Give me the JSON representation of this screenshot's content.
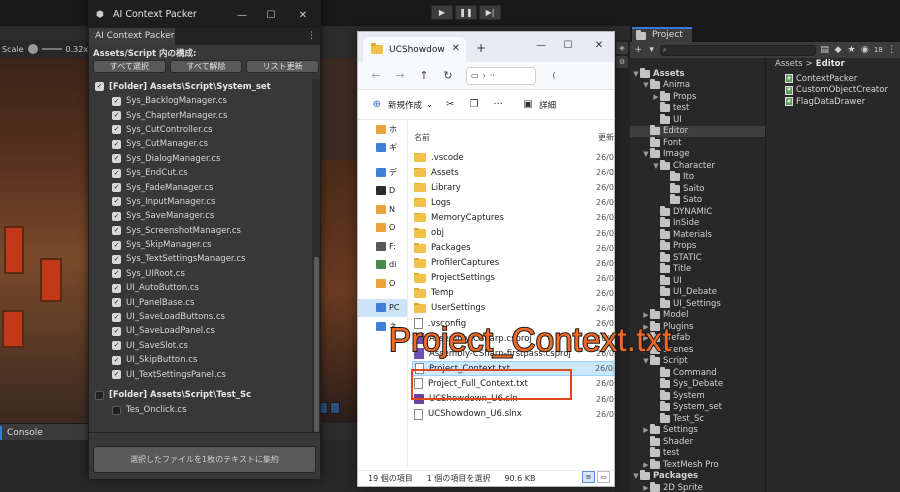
{
  "unity": {
    "play_icon": "play-icon",
    "pause_icon": "pause-icon",
    "step_icon": "step-icon",
    "scale_label": "Scale",
    "scale_value": "0.32x",
    "console_tab": "Console"
  },
  "packer": {
    "title": "AI Context Packer",
    "tab_label": "AI Context Packer",
    "heading": "Assets/Script 内の構成:",
    "btn_select_all": "すべて選択",
    "btn_deselect_all": "すべて解除",
    "btn_refresh": "リスト更新",
    "folder_1": "[Folder] Assets\\Script\\System_set",
    "files_1": [
      "Sys_BacklogManager.cs",
      "Sys_ChapterManager.cs",
      "Sys_CutController.cs",
      "Sys_CutManager.cs",
      "Sys_DialogManager.cs",
      "Sys_EndCut.cs",
      "Sys_FadeManager.cs",
      "Sys_InputManager.cs",
      "Sys_SaveManager.cs",
      "Sys_ScreenshotManager.cs",
      "Sys_SkipManager.cs",
      "Sys_TextSettingsManager.cs",
      "Sys_UIRoot.cs",
      "UI_AutoButton.cs",
      "UI_PanelBase.cs",
      "UI_SaveLoadButtons.cs",
      "UI_SaveLoadPanel.cs",
      "UI_SaveSlot.cs",
      "UI_SkipButton.cs",
      "UI_TextSettingsPanel.cs"
    ],
    "folder_2": "[Folder] Assets\\Script\\Test_Sc",
    "files_2": [
      "Tes_Onclick.cs"
    ],
    "concat_button": "選択したファイルを1枚のテキストに集約"
  },
  "explorer": {
    "tab_title": "UCShowdow",
    "addr_more": "··",
    "addr_tail": "(",
    "new_button": "新規作成",
    "details_button": "詳細",
    "col_name": "名前",
    "col_date": "更新",
    "nav_items": [
      "ホ",
      "ギ",
      "デ",
      "D",
      "N",
      "O",
      "F:",
      "di",
      "O",
      "PC",
      "ネ"
    ],
    "files": [
      {
        "name": ".vscode",
        "date": "26/0",
        "type": "folder"
      },
      {
        "name": "Assets",
        "date": "26/0",
        "type": "folder"
      },
      {
        "name": "Library",
        "date": "26/0",
        "type": "folder"
      },
      {
        "name": "Logs",
        "date": "26/0",
        "type": "folder"
      },
      {
        "name": "MemoryCaptures",
        "date": "26/0",
        "type": "folder"
      },
      {
        "name": "obj",
        "date": "26/0",
        "type": "folder"
      },
      {
        "name": "Packages",
        "date": "26/0",
        "type": "folder"
      },
      {
        "name": "ProfilerCaptures",
        "date": "26/0",
        "type": "folder"
      },
      {
        "name": "ProjectSettings",
        "date": "26/0",
        "type": "folder"
      },
      {
        "name": "Temp",
        "date": "26/0",
        "type": "folder"
      },
      {
        "name": "UserSettings",
        "date": "26/0",
        "type": "folder"
      },
      {
        "name": ".vsconfig",
        "date": "26/0",
        "type": "doc"
      },
      {
        "name": "Assembly-CSharp.csproj",
        "date": "26/0",
        "type": "proj"
      },
      {
        "name": "Assembly-CSharp-firstpass.csproj",
        "date": "26/0",
        "type": "proj"
      },
      {
        "name": "Project_Context.txt",
        "date": "26/0",
        "type": "doc"
      },
      {
        "name": "Project_Full_Context.txt",
        "date": "26/0",
        "type": "doc"
      },
      {
        "name": "UCShowdown_U6.sln",
        "date": "26/0",
        "type": "sln"
      },
      {
        "name": "UCShowdown_U6.slnx",
        "date": "26/0",
        "type": "doc"
      }
    ],
    "selected_index": 14,
    "status_count": "19 個の項目",
    "status_selected": "1 個の項目を選択",
    "status_size": "90.6 KB"
  },
  "project": {
    "tab_label": "Project",
    "breadcrumb_root": "Assets",
    "breadcrumb_sep": ">",
    "breadcrumb_current": "Editor",
    "badge_count": "18",
    "tree": [
      {
        "label": "Assets",
        "depth": 0,
        "arrow": "▼",
        "bold": true
      },
      {
        "label": "Anima",
        "depth": 1,
        "arrow": "▼"
      },
      {
        "label": "Props",
        "depth": 2,
        "arrow": "▶"
      },
      {
        "label": "test",
        "depth": 2,
        "arrow": ""
      },
      {
        "label": "UI",
        "depth": 2,
        "arrow": ""
      },
      {
        "label": "Editor",
        "depth": 1,
        "arrow": "",
        "sel": true
      },
      {
        "label": "Font",
        "depth": 1,
        "arrow": ""
      },
      {
        "label": "Image",
        "depth": 1,
        "arrow": "▼"
      },
      {
        "label": "Character",
        "depth": 2,
        "arrow": "▼"
      },
      {
        "label": "Ito",
        "depth": 3,
        "arrow": ""
      },
      {
        "label": "Saito",
        "depth": 3,
        "arrow": ""
      },
      {
        "label": "Sato",
        "depth": 3,
        "arrow": ""
      },
      {
        "label": "DYNAMIC",
        "depth": 2,
        "arrow": ""
      },
      {
        "label": "InSide",
        "depth": 2,
        "arrow": ""
      },
      {
        "label": "Materials",
        "depth": 2,
        "arrow": ""
      },
      {
        "label": "Props",
        "depth": 2,
        "arrow": ""
      },
      {
        "label": "STATIC",
        "depth": 2,
        "arrow": ""
      },
      {
        "label": "Title",
        "depth": 2,
        "arrow": ""
      },
      {
        "label": "UI",
        "depth": 2,
        "arrow": ""
      },
      {
        "label": "UI_Debate",
        "depth": 2,
        "arrow": ""
      },
      {
        "label": "UI_Settings",
        "depth": 2,
        "arrow": ""
      },
      {
        "label": "Model",
        "depth": 1,
        "arrow": "▶"
      },
      {
        "label": "Plugins",
        "depth": 1,
        "arrow": "▶"
      },
      {
        "label": "Prefab",
        "depth": 1,
        "arrow": "▶"
      },
      {
        "label": "Scenes",
        "depth": 1,
        "arrow": "▶"
      },
      {
        "label": "Script",
        "depth": 1,
        "arrow": "▼"
      },
      {
        "label": "Command",
        "depth": 2,
        "arrow": ""
      },
      {
        "label": "Sys_Debate",
        "depth": 2,
        "arrow": ""
      },
      {
        "label": "System",
        "depth": 2,
        "arrow": ""
      },
      {
        "label": "System_set",
        "depth": 2,
        "arrow": ""
      },
      {
        "label": "Test_Sc",
        "depth": 2,
        "arrow": ""
      },
      {
        "label": "Settings",
        "depth": 1,
        "arrow": "▶"
      },
      {
        "label": "Shader",
        "depth": 1,
        "arrow": ""
      },
      {
        "label": "test",
        "depth": 1,
        "arrow": ""
      },
      {
        "label": "TextMesh Pro",
        "depth": 1,
        "arrow": "▶"
      },
      {
        "label": "Packages",
        "depth": 0,
        "arrow": "▼",
        "bold": true
      },
      {
        "label": "2D Sprite",
        "depth": 1,
        "arrow": "▶"
      }
    ],
    "files": [
      "ContextPacker",
      "CustomObjectCreator",
      "FlagDataDrawer"
    ]
  },
  "annotation": {
    "text": "Project_Context.txt",
    "color": "#f16a25",
    "box_color": "#e0481e"
  }
}
